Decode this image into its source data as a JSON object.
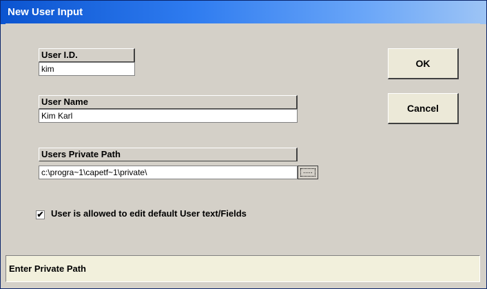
{
  "window": {
    "title": "New User Input"
  },
  "fields": {
    "user_id": {
      "label": "User I.D.",
      "value": "kim"
    },
    "user_name": {
      "label": "User Name",
      "value": "Kim Karl"
    },
    "private_path": {
      "label": "Users Private Path",
      "value": "c:\\progra~1\\capetf~1\\private\\"
    }
  },
  "browse": {
    "icon": "ellipsis-icon",
    "glyph": "....."
  },
  "checkbox": {
    "checked": true,
    "mark": "✔",
    "label": "User is allowed to edit default User text/Fields"
  },
  "buttons": {
    "ok": "OK",
    "cancel": "Cancel"
  },
  "status": {
    "text": "Enter Private Path"
  }
}
